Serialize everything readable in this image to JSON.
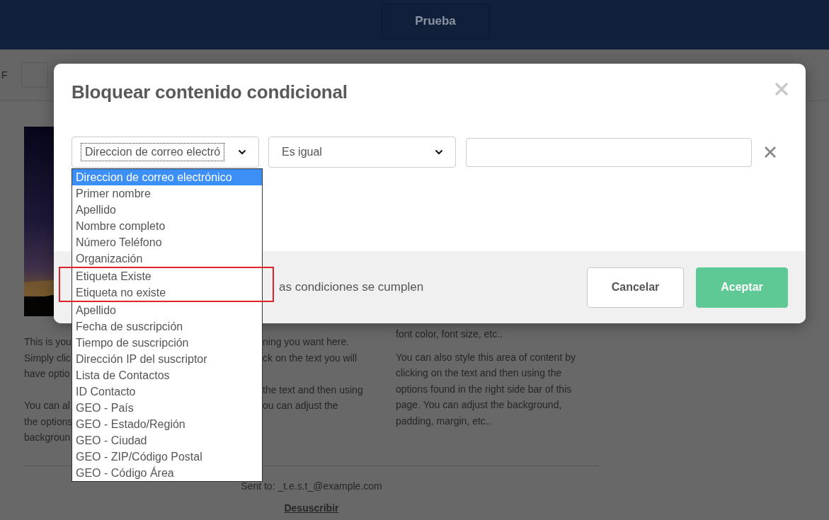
{
  "header": {
    "button": "Prueba"
  },
  "toolbar": {
    "text": "F"
  },
  "email": {
    "picture": {
      "kind": "picture"
    },
    "left_fragments": [
      [
        "This is you",
        "Simply clic",
        "have optio"
      ],
      [
        "You can al",
        "the options",
        "backgroun"
      ]
    ],
    "middle_fragments": [
      [
        "ning you want here.",
        "ck on the text you will"
      ],
      [
        "the text and then using",
        "ou can adjust the"
      ]
    ],
    "right_top": "font color, font size, etc..",
    "right_paragraph": "You can also style this area of content by clicking on the text and then using the options found in the right side bar of this page. You can adjust the background, padding, margin, etc..",
    "sent_to": "Sent to: _t.e.s.t_@example.com",
    "unsubscribe": "Desuscribir"
  },
  "dialog": {
    "title": "Bloquear contenido condicional",
    "condition": {
      "field": {
        "value": "Direccion de correo electró",
        "focused": true,
        "expanded": true,
        "options": [
          {
            "label": "Direccion de correo electrónico",
            "selected": true,
            "highlighted": false
          },
          {
            "label": "Primer nombre",
            "selected": false,
            "highlighted": false
          },
          {
            "label": "Apellido",
            "selected": false,
            "highlighted": false
          },
          {
            "label": "Nombre completo",
            "selected": false,
            "highlighted": false
          },
          {
            "label": "Número Teléfono",
            "selected": false,
            "highlighted": false
          },
          {
            "label": "Organización",
            "selected": false,
            "highlighted": false
          },
          {
            "label": "Etiqueta Existe",
            "selected": false,
            "highlighted": true
          },
          {
            "label": "Etiqueta no existe",
            "selected": false,
            "highlighted": true
          },
          {
            "label": "Apellido",
            "selected": false,
            "highlighted": false
          },
          {
            "label": "Fecha de suscripción",
            "selected": false,
            "highlighted": false
          },
          {
            "label": "Tiempo de suscripción",
            "selected": false,
            "highlighted": false
          },
          {
            "label": "Dirección IP del suscriptor",
            "selected": false,
            "highlighted": false
          },
          {
            "label": "Lista de Contactos",
            "selected": false,
            "highlighted": false
          },
          {
            "label": "ID Contacto",
            "selected": false,
            "highlighted": false
          },
          {
            "label": "GEO - País",
            "selected": false,
            "highlighted": false
          },
          {
            "label": "GEO - Estado/Región",
            "selected": false,
            "highlighted": false
          },
          {
            "label": "GEO - Ciudad",
            "selected": false,
            "highlighted": false
          },
          {
            "label": "GEO - ZIP/Código Postal",
            "selected": false,
            "highlighted": false
          },
          {
            "label": "GEO - Código Área",
            "selected": false,
            "highlighted": false
          }
        ]
      },
      "operator": {
        "value": "Es igual"
      }
    },
    "footer_text": "as condiciones se cumplen",
    "buttons": [
      {
        "label": "Cancelar",
        "kind": "secondary"
      },
      {
        "label": "Aceptar",
        "kind": "primary"
      }
    ]
  }
}
